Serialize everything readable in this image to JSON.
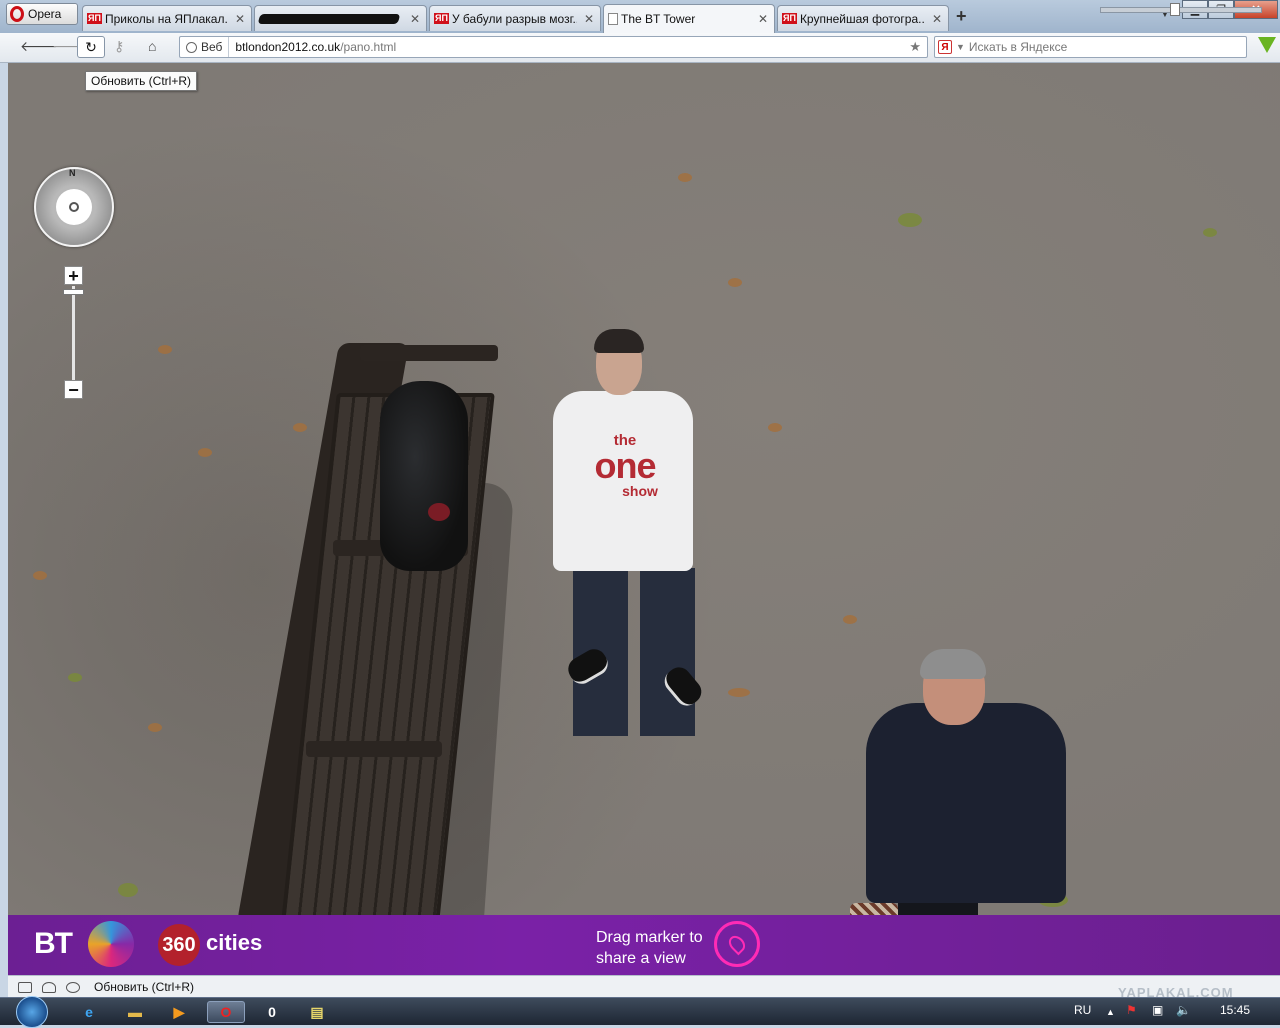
{
  "browser": {
    "menu_label": "Opera",
    "tabs": [
      {
        "title": "Приколы на ЯПлакал...",
        "favicon": "ЯП"
      },
      {
        "title": "",
        "favicon": "redacted"
      },
      {
        "title": "У бабули разрыв мозг...",
        "favicon": "ЯП"
      },
      {
        "title": "The BT Tower",
        "favicon": "page"
      },
      {
        "title": "Крупнейшая фотогра...",
        "favicon": "ЯП"
      }
    ],
    "new_tab": "+",
    "address": {
      "security_label": "Веб",
      "host": "btlondon2012.co.uk",
      "path": "/pano.html"
    },
    "search": {
      "placeholder": "Искать в Яндексе",
      "engine_badge": "Я"
    },
    "tooltip": "Обновить (Ctrl+R)"
  },
  "panorama": {
    "compass_label": "N",
    "zoom_in": "+",
    "zoom_out": "−",
    "shirt_text": {
      "line1": "the",
      "line2": "one",
      "line3": "show"
    }
  },
  "banner": {
    "brand": "BT",
    "badge": "360",
    "badge_suffix": "cities",
    "cta_line1": "Drag marker to",
    "cta_line2": "share a view"
  },
  "status_bar": {
    "text": "Обновить (Ctrl+R)"
  },
  "taskbar": {
    "language": "RU",
    "clock": "15:45",
    "watermark": "YAPLAKAL.COM"
  }
}
